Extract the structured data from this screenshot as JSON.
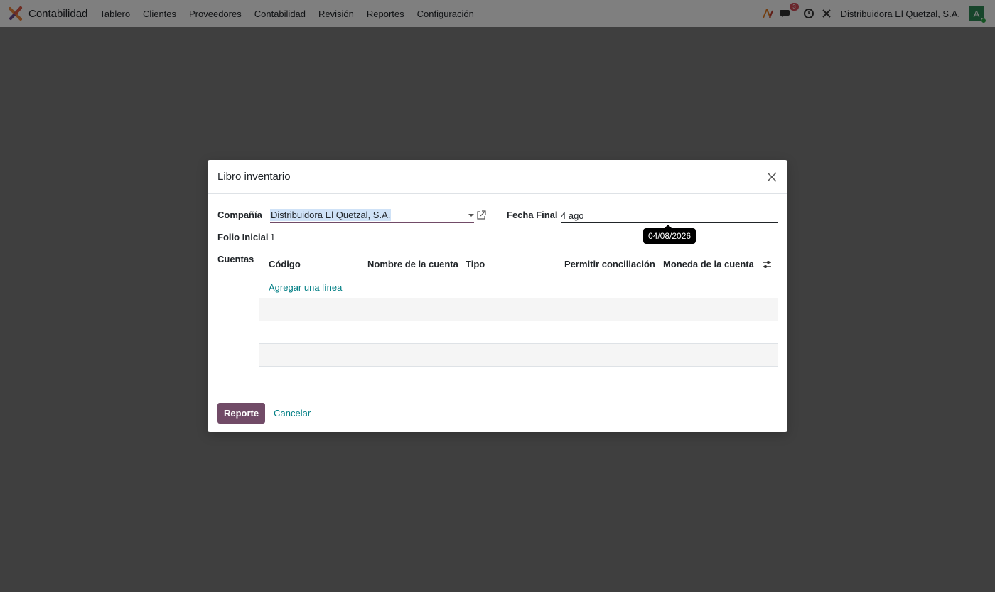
{
  "navbar": {
    "app_name": "Contabilidad",
    "menu": [
      "Tablero",
      "Clientes",
      "Proveedores",
      "Contabilidad",
      "Revisión",
      "Reportes",
      "Configuración"
    ],
    "messages_count": "3",
    "company": "Distribuidora El Quetzal, S.A.",
    "avatar_initial": "A"
  },
  "dialog": {
    "title": "Libro inventario",
    "company_label": "Compañía",
    "company_value": "Distribuidora El Quetzal, S.A.",
    "end_date_label": "Fecha Final",
    "end_date_value": "4 ago",
    "end_date_tooltip": "04/08/2026",
    "folio_label": "Folio Inicial",
    "folio_value": "1",
    "accounts_label": "Cuentas",
    "columns": [
      "Código",
      "Nombre de la cuenta",
      "Tipo",
      "Permitir conciliación",
      "Moneda de la cuenta"
    ],
    "add_line": "Agregar una línea",
    "report_button": "Reporte",
    "cancel_button": "Cancelar"
  },
  "colors": {
    "primary": "#714b67",
    "link": "#017e84",
    "badge": "#d44c59",
    "avatar": "#2e8b57"
  }
}
